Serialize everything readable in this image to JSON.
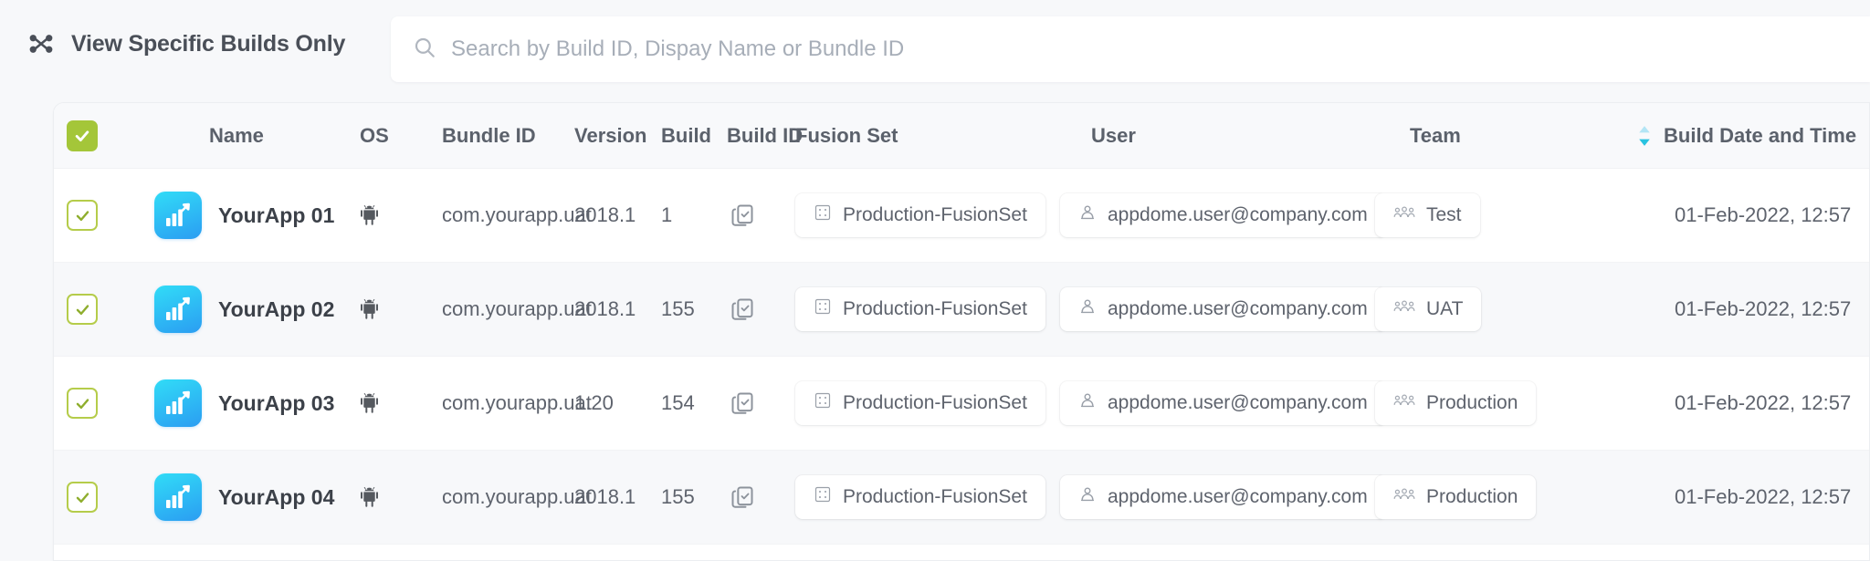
{
  "topbar": {
    "merge_icon": "merge-branch-icon",
    "view_toggle_label": "View Specific Builds Only",
    "search": {
      "icon": "search-icon",
      "placeholder": "Search by Build ID, Dispay Name or Bundle ID",
      "value": ""
    }
  },
  "table": {
    "select_all_checked": true,
    "columns": {
      "name": "Name",
      "os": "OS",
      "bundle_id": "Bundle ID",
      "version": "Version",
      "build": "Build",
      "build_id": "Build ID",
      "fusion_set": "Fusion Set",
      "user": "User",
      "team": "Team",
      "build_date": "Build Date and Time"
    },
    "sort": {
      "column": "Build Date and Time",
      "icon": "sort-arrows-icon",
      "up_color": "#b3e5f5",
      "down_color": "#29c3e0"
    },
    "rows": [
      {
        "checked": true,
        "app_icon": "bar-chart-app-icon",
        "name": "YourApp 01",
        "os": "android-icon",
        "bundle_id": "com.yourapp.uat",
        "version": "2018.1",
        "build": "1",
        "build_id_action": "copy-icon",
        "fusion_set": "Production-FusionSet",
        "user": "appdome.user@company.com",
        "team": "Test",
        "build_date": "01-Feb-2022, 12:57"
      },
      {
        "checked": true,
        "app_icon": "bar-chart-app-icon",
        "name": "YourApp 02",
        "os": "android-icon",
        "bundle_id": "com.yourapp.uat",
        "version": "2018.1",
        "build": "155",
        "build_id_action": "copy-icon",
        "fusion_set": "Production-FusionSet",
        "user": "appdome.user@company.com",
        "team": "UAT",
        "build_date": "01-Feb-2022, 12:57"
      },
      {
        "checked": true,
        "app_icon": "bar-chart-app-icon",
        "name": "YourApp 03",
        "os": "android-icon",
        "bundle_id": "com.yourapp.uat",
        "version": "1.20",
        "build": "154",
        "build_id_action": "copy-icon",
        "fusion_set": "Production-FusionSet",
        "user": "appdome.user@company.com",
        "team": "Production",
        "build_date": "01-Feb-2022, 12:57"
      },
      {
        "checked": true,
        "app_icon": "bar-chart-app-icon",
        "name": "YourApp 04",
        "os": "android-icon",
        "bundle_id": "com.yourapp.uat",
        "version": "2018.1",
        "build": "155",
        "build_id_action": "copy-icon",
        "fusion_set": "Production-FusionSet",
        "user": "appdome.user@company.com",
        "team": "Production",
        "build_date": "01-Feb-2022, 12:57"
      }
    ]
  },
  "colors": {
    "page_bg": "#f7f8fa",
    "card_bg": "#ffffff",
    "header_bg": "#f8f9fb",
    "row_alt_bg": "#f7f8fa",
    "checkbox_green": "#a4c639",
    "checkbox_border": "#b5cc4a",
    "app_icon_cyan": "#31dcf7",
    "app_icon_blue": "#2b9df2",
    "text_primary": "#3c4149",
    "text_secondary": "#5e636d",
    "text_placeholder": "#a7aeb8"
  }
}
